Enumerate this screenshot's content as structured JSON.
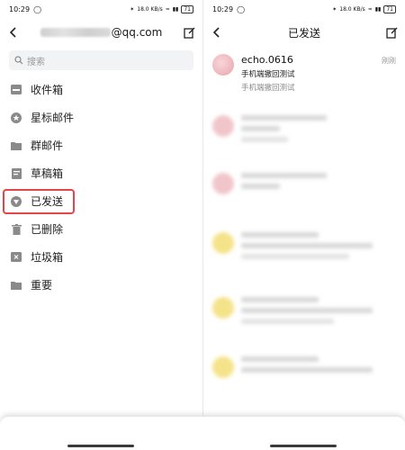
{
  "status_bar": {
    "time": "10:29",
    "indicators": "18.0 KB/s",
    "battery": "71"
  },
  "left_screen": {
    "account_suffix": "@qq.com",
    "search_placeholder": "搜索",
    "folders": [
      {
        "label": "收件箱",
        "icon": "inbox-icon"
      },
      {
        "label": "星标邮件",
        "icon": "star-icon"
      },
      {
        "label": "群邮件",
        "icon": "folder-icon"
      },
      {
        "label": "草稿箱",
        "icon": "draft-icon"
      },
      {
        "label": "已发送",
        "icon": "sent-icon",
        "highlighted": true
      },
      {
        "label": "已删除",
        "icon": "trash-icon"
      },
      {
        "label": "垃圾箱",
        "icon": "spam-icon"
      },
      {
        "label": "重要",
        "icon": "folder-icon"
      }
    ]
  },
  "right_screen": {
    "title": "已发送",
    "first_mail": {
      "sender": "echo.0616",
      "time": "刚刚",
      "subject": "手机端撤回测试",
      "preview": "手机端撤回测试"
    }
  },
  "colors": {
    "highlight_border": "#e8434b",
    "icon_gray": "#8a8a8a",
    "avatar_pink": "#f3c4c8",
    "avatar_yellow": "#f6e58d"
  }
}
